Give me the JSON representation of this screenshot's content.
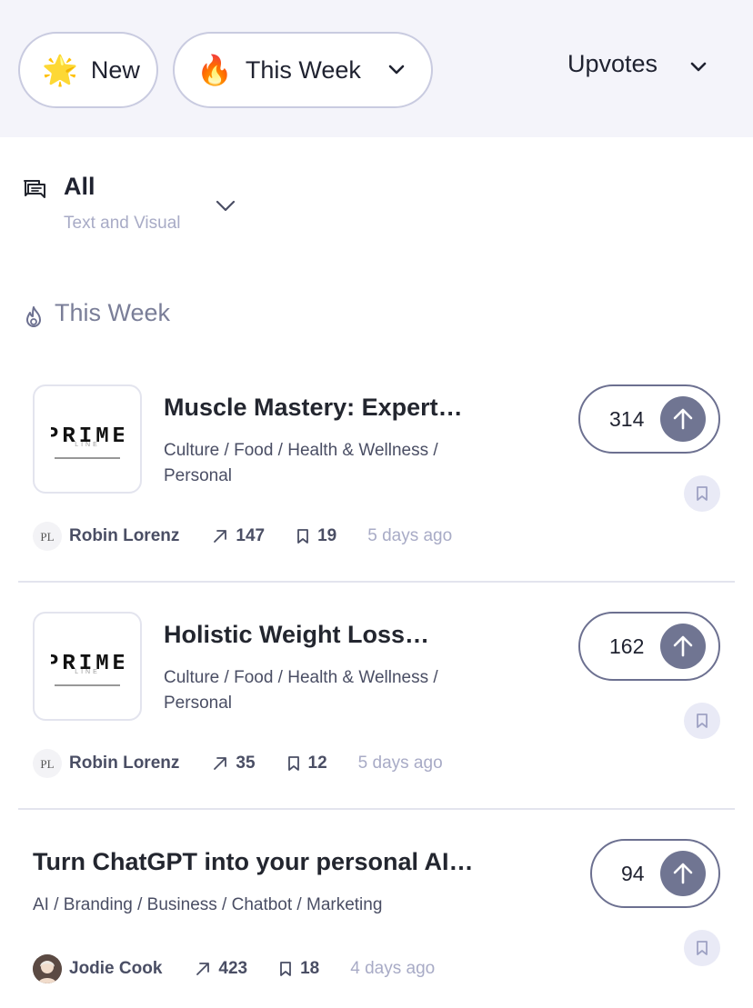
{
  "filters": {
    "new_label": "New",
    "new_icon": "star-emoji",
    "period_label": "This Week",
    "period_icon": "fire-emoji",
    "sort_label": "Upvotes"
  },
  "category": {
    "title": "All",
    "subtitle": "Text and Visual",
    "icon": "chat-bubbles-icon"
  },
  "section": {
    "title": "This Week",
    "icon": "flame-icon"
  },
  "posts": [
    {
      "title": "Muscle Mastery: Expert…",
      "tags_line1": "Culture / Food / Health & Wellness /",
      "tags_line2": "Personal",
      "logo_text": "PRIME",
      "logo_sub": "LINE",
      "votes": "314",
      "author": "Robin Lorenz",
      "shares": "147",
      "saves": "19",
      "time": "5 days ago"
    },
    {
      "title": "Holistic Weight Loss…",
      "tags_line1": "Culture / Food / Health & Wellness /",
      "tags_line2": "Personal",
      "logo_text": "PRIME",
      "logo_sub": "LINE",
      "votes": "162",
      "author": "Robin Lorenz",
      "shares": "35",
      "saves": "12",
      "time": "5 days ago"
    },
    {
      "title": "Turn ChatGPT into your personal AI…",
      "tags_line1": "AI / Branding / Business / Chatbot / Marketing",
      "votes": "94",
      "author": "Jodie Cook",
      "shares": "423",
      "saves": "18",
      "time": "4 days ago"
    }
  ]
}
